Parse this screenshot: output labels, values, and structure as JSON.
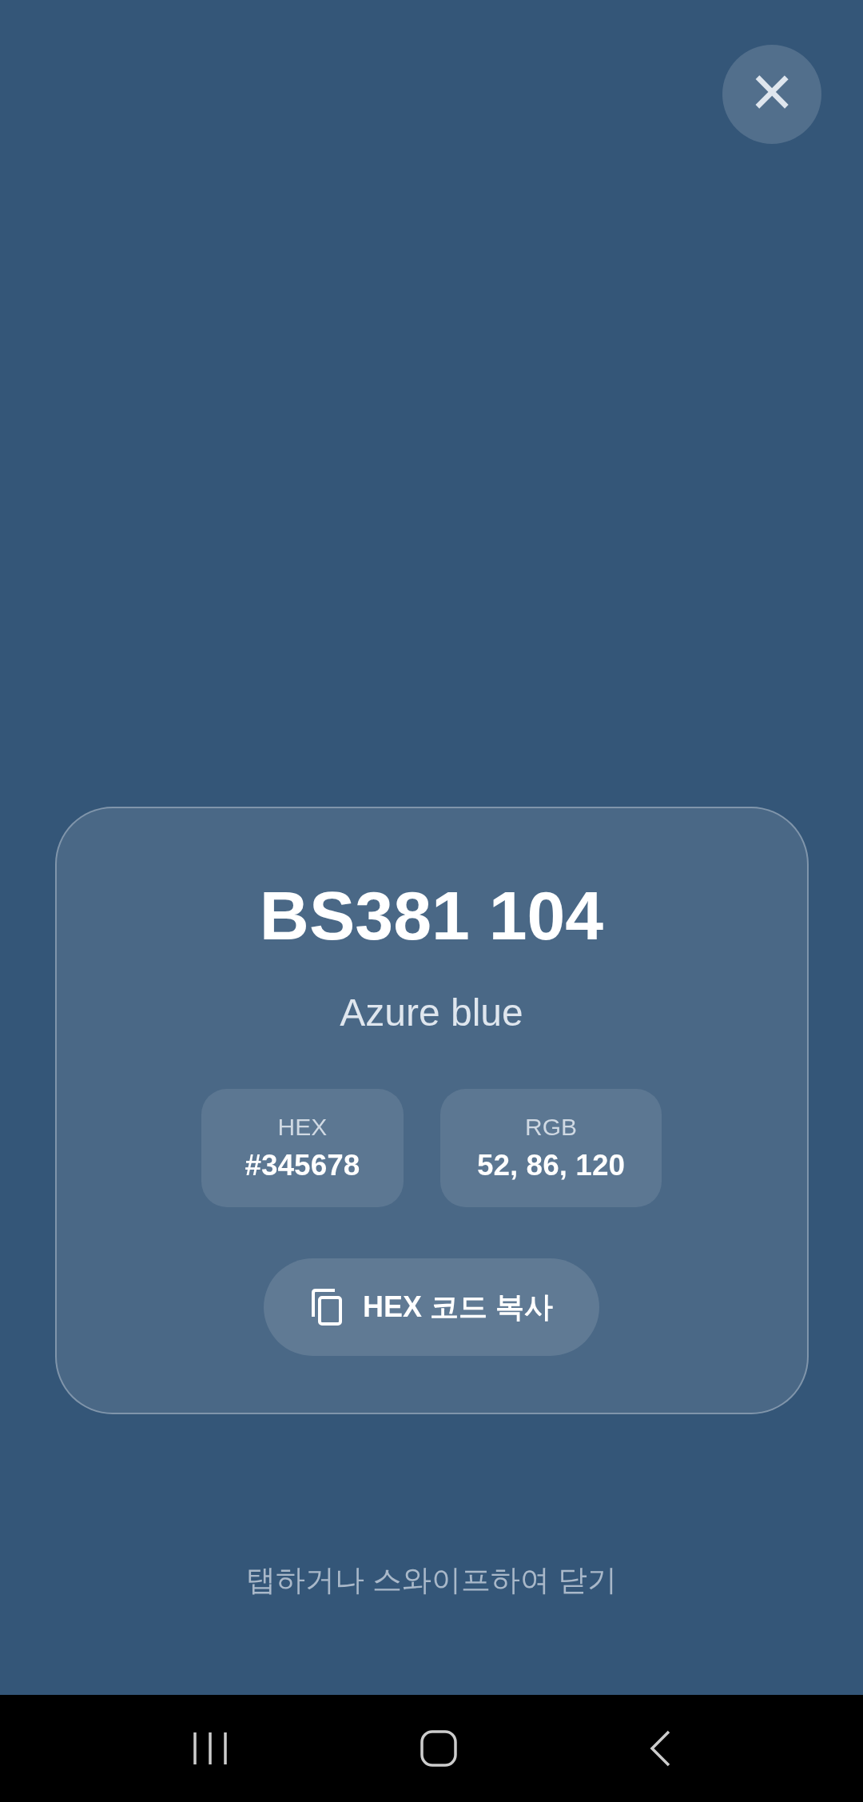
{
  "close_button": {
    "label": "×"
  },
  "card": {
    "title": "BS381 104",
    "subtitle": "Azure blue",
    "swatches": [
      {
        "label": "HEX",
        "value": "#345678"
      },
      {
        "label": "RGB",
        "value": "52, 86, 120"
      }
    ],
    "copy_button": {
      "label": "HEX 코드 복사"
    }
  },
  "hint": "탭하거나 스와이프하여 닫기"
}
